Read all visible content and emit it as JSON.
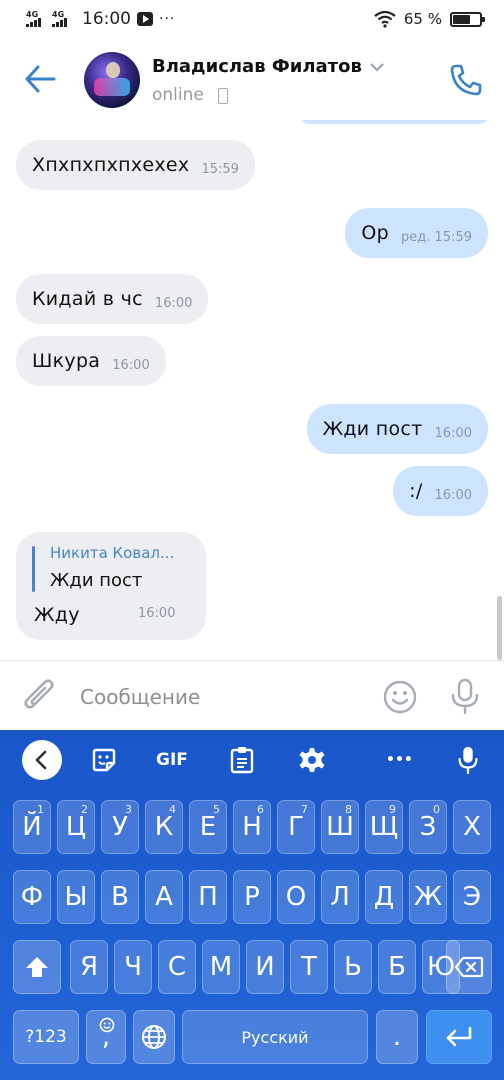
{
  "status_bar": {
    "net1": "4G",
    "net2": "4G",
    "time": "16:00",
    "dots": "···",
    "battery_text": "65 %",
    "battery_level": 0.65
  },
  "header": {
    "name": "Владислав Филатов",
    "status": "online",
    "accent": "#3b82c8"
  },
  "messages": [
    {
      "dir": "in",
      "text": "Хпхпхпхпхехех",
      "time": "15:59"
    },
    {
      "dir": "out",
      "text": "Ор",
      "time": "ред. 15:59"
    },
    {
      "dir": "in",
      "text": "Кидай в чс",
      "time": "16:00"
    },
    {
      "dir": "in",
      "text": "Шкура",
      "time": "16:00"
    },
    {
      "dir": "out",
      "text": "Жди пост",
      "time": "16:00"
    },
    {
      "dir": "out",
      "text": ":/",
      "time": "16:00"
    },
    {
      "dir": "in",
      "reply_name": "Никита Ковал...",
      "reply_text": "Жди пост",
      "text": "Жду",
      "time": "16:00"
    }
  ],
  "composer": {
    "placeholder": "Сообщение"
  },
  "keyboard": {
    "toolbar": {
      "gif": "GIF",
      "more": "•••"
    },
    "row1": [
      {
        "k": "Й",
        "h": "1"
      },
      {
        "k": "Ц",
        "h": "2"
      },
      {
        "k": "У",
        "h": "3"
      },
      {
        "k": "К",
        "h": "4"
      },
      {
        "k": "Е",
        "h": "5"
      },
      {
        "k": "Н",
        "h": "6"
      },
      {
        "k": "Г",
        "h": "7"
      },
      {
        "k": "Ш",
        "h": "8"
      },
      {
        "k": "Щ",
        "h": "9"
      },
      {
        "k": "З",
        "h": "0"
      },
      {
        "k": "Х",
        "h": ""
      }
    ],
    "row2": [
      "Ф",
      "Ы",
      "В",
      "А",
      "П",
      "Р",
      "О",
      "Л",
      "Д",
      "Ж",
      "Э"
    ],
    "row3": [
      "Я",
      "Ч",
      "С",
      "М",
      "И",
      "Т",
      "Ь",
      "Б",
      "Ю"
    ],
    "row4": {
      "symbols": "?123",
      "comma": ",",
      "space": "Русский",
      "period": "."
    }
  }
}
